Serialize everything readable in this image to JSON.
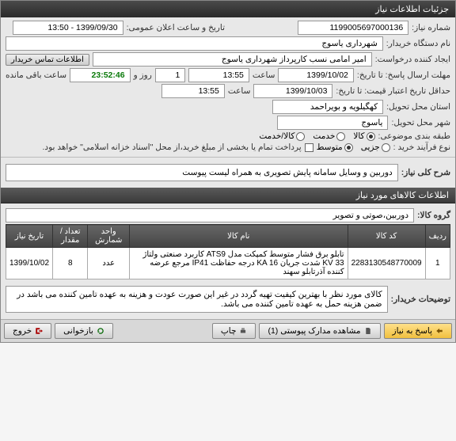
{
  "window_title": "جزئیات اطلاعات نیاز",
  "header": {
    "need_no_label": "شماره نیاز:",
    "need_no": "1199005697000136",
    "announce_label": "تاریخ و ساعت اعلان عمومی:",
    "announce": "1399/09/30 - 13:50",
    "buyer_device_label": "نام دستگاه خریدار:",
    "buyer_device": "شهرداری یاسوج",
    "creator_label": "ایجاد کننده درخواست:",
    "creator": "امیر امامی نسب کارپرداز شهرداری یاسوج",
    "contact_btn": "اطلاعات تماس خریدار",
    "deadline_label": "مهلت ارسال پاسخ: تا تاریخ:",
    "deadline_date": "1399/10/02",
    "time_label": "ساعت",
    "deadline_time": "13:55",
    "remain_days": "1",
    "remain_days_label": "روز و",
    "remain_time": "23:52:46",
    "remain_suffix": "ساعت باقی مانده",
    "min_valid_label": "حداقل تاریخ اعتبار قیمت: تا تاریخ:",
    "min_valid_date": "1399/10/03",
    "min_valid_time": "13:55",
    "delivery_state_label": "استان محل تحویل:",
    "delivery_state": "کهگیلویه و بویراحمد",
    "delivery_city_label": "شهر محل تحویل:",
    "delivery_city": "یاسوج",
    "category_label": "طبقه بندی موضوعی:",
    "cat_goods": "کالا",
    "cat_service": "خدمت",
    "cat_goods_service": "کالا/خدمت",
    "process_type_label": "نوع فرآیند خرید :",
    "proc_small": "جزیی",
    "proc_medium": "متوسط",
    "pay_note": "پرداخت تمام یا بخشی از مبلغ خرید،از محل \"اسناد خزانه اسلامی\" خواهد بود."
  },
  "need_desc": {
    "label": "شرح کلی نیاز:",
    "text": "دوربین و وسایل سامانه پایش تصویری به همراه لیست پیوست"
  },
  "goods_section_title": "اطلاعات کالاهای مورد نیاز",
  "goods_group_label": "گروه کالا:",
  "goods_group": "دوربین،صوتی و تصویر",
  "table": {
    "headers": {
      "row": "ردیف",
      "code": "کد کالا",
      "name": "نام کالا",
      "unit": "واحد شمارش",
      "qty": "تعداد / مقدار",
      "need_date": "تاریخ نیاز"
    },
    "rows": [
      {
        "row": "1",
        "code": "2283130548770009",
        "name": "تابلو برق فشار متوسط کمپکت مدل ATS9 کاربرد صنعتی ولتاژ KV 33 شدت جریان KA 16 درجه حفاظت IP41 مرجع عرضه کننده آذرتابلو سهند",
        "unit": "عدد",
        "qty": "8",
        "need_date": "1399/10/02"
      }
    ]
  },
  "buyer_notes": {
    "label": "توضیحات خریدار:",
    "text": "کالای مورد نظر با بهترین کیفیت تهیه گردد در غیر این صورت عودت و هزینه به عهده تامین کننده می باشد در ضمن هزینه حمل به عهده تامین کننده می باشد."
  },
  "footer": {
    "reply": "پاسخ به نیاز",
    "attachments": "مشاهده مدارک پیوستی (1)",
    "print": "چاپ",
    "refresh": "بازخوانی",
    "exit": "خروج"
  }
}
